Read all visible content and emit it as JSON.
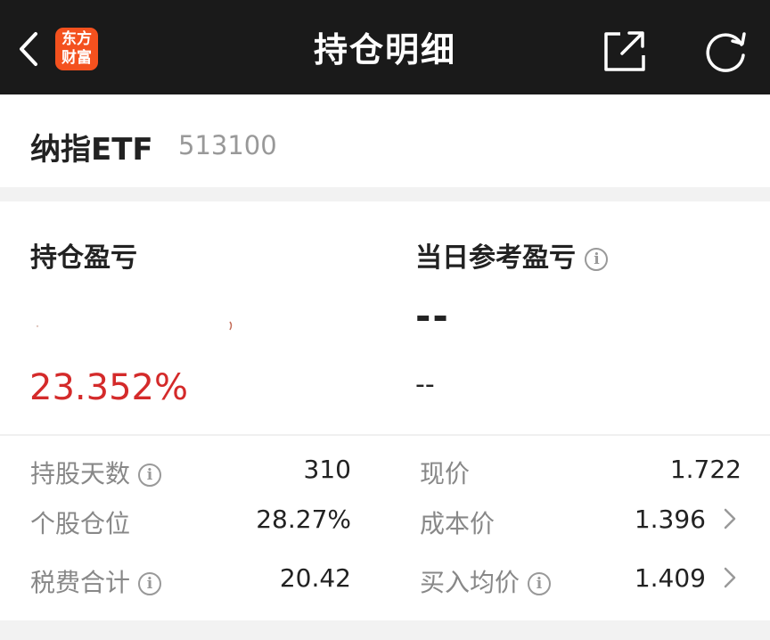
{
  "header": {
    "title": "持仓明细",
    "logo_line1": "东方",
    "logo_line2": "财富"
  },
  "stock": {
    "name": "纳指ETF",
    "code": "513100"
  },
  "summary": {
    "holding_pl_label": "持仓盈亏",
    "holding_pl_percent": "23.352%",
    "daily_ref_pl_label": "当日参考盈亏",
    "daily_ref_pl_value": "--",
    "daily_ref_pl_percent": "--"
  },
  "details": {
    "hold_days_label": "持股天数",
    "hold_days_value": "310",
    "position_ratio_label": "个股仓位",
    "position_ratio_value": "28.27%",
    "fees_label": "税费合计",
    "fees_value": "20.42",
    "price_label": "现价",
    "price_value": "1.722",
    "cost_label": "成本价",
    "cost_value": "1.396",
    "avg_buy_label": "买入均价",
    "avg_buy_value": "1.409"
  },
  "colors": {
    "topbar": "#1a1a1a",
    "logo": "#f4511e",
    "profit": "#d42a2a"
  }
}
